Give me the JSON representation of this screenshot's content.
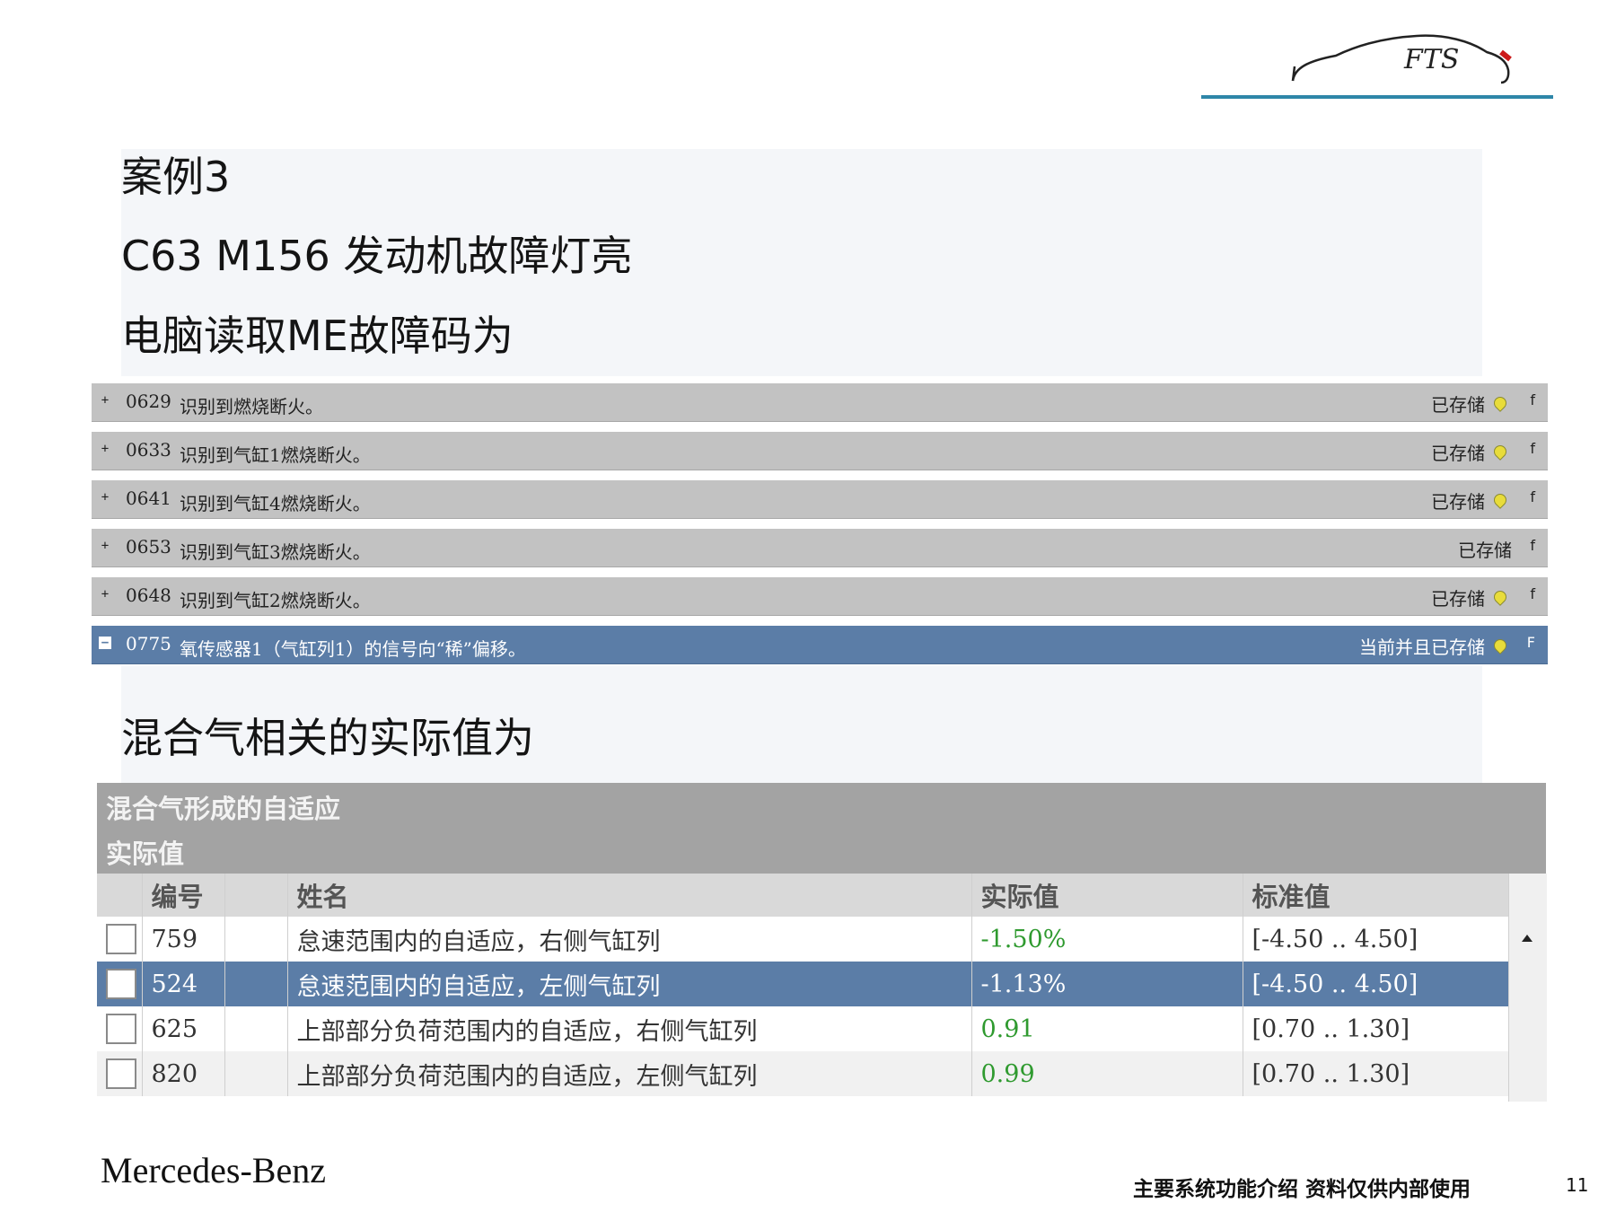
{
  "logo": {
    "text": "FTS"
  },
  "slide": {
    "case_title": "案例3",
    "subtitle": "C63 M156 发动机故障灯亮",
    "read_line": "电脑读取ME故障码为",
    "values_line": "混合气相关的实际值为"
  },
  "faults": [
    {
      "code": "0629",
      "desc": "识别到燃烧断火。",
      "status": "已存储",
      "bulb": true,
      "flag": "f"
    },
    {
      "code": "0633",
      "desc": "识别到气缸1燃烧断火。",
      "status": "已存储",
      "bulb": true,
      "flag": "f"
    },
    {
      "code": "0641",
      "desc": "识别到气缸4燃烧断火。",
      "status": "已存储",
      "bulb": true,
      "flag": "f"
    },
    {
      "code": "0653",
      "desc": "识别到气缸3燃烧断火。",
      "status": "已存储",
      "bulb": false,
      "flag": "f"
    },
    {
      "code": "0648",
      "desc": "识别到气缸2燃烧断火。",
      "status": "已存储",
      "bulb": true,
      "flag": "f"
    },
    {
      "code": "0775",
      "desc": "氧传感器1（气缸列1）的信号向“稀”偏移。",
      "status": "当前并且已存储",
      "bulb": true,
      "flag": "F",
      "selected": true
    }
  ],
  "actual_values": {
    "title": "混合气形成的自适应",
    "subtitle": "实际值",
    "columns": {
      "number": "编号",
      "name": "姓名",
      "value": "实际值",
      "standard": "标准值"
    },
    "rows": [
      {
        "number": "759",
        "name": "怠速范围内的自适应，右侧气缸列",
        "value": "-1.50%",
        "standard": "[-4.50 .. 4.50]"
      },
      {
        "number": "524",
        "name": "怠速范围内的自适应，左侧气缸列",
        "value": "-1.13%",
        "standard": "[-4.50 .. 4.50]",
        "selected": true
      },
      {
        "number": "625",
        "name": "上部部分负荷范围内的自适应，右侧气缸列",
        "value": "0.91",
        "standard": "[0.70 .. 1.30]"
      },
      {
        "number": "820",
        "name": "上部部分负荷范围内的自适应，左侧气缸列",
        "value": "0.99",
        "standard": "[0.70 .. 1.30]"
      }
    ]
  },
  "footer": {
    "brand": "Mercedes-Benz",
    "note": "主要系统功能介绍  资料仅供内部使用",
    "page": "11"
  },
  "colors": {
    "accent_line": "#2e86a8",
    "selection": "#5b7da7",
    "value_green": "#2f9a2f"
  }
}
